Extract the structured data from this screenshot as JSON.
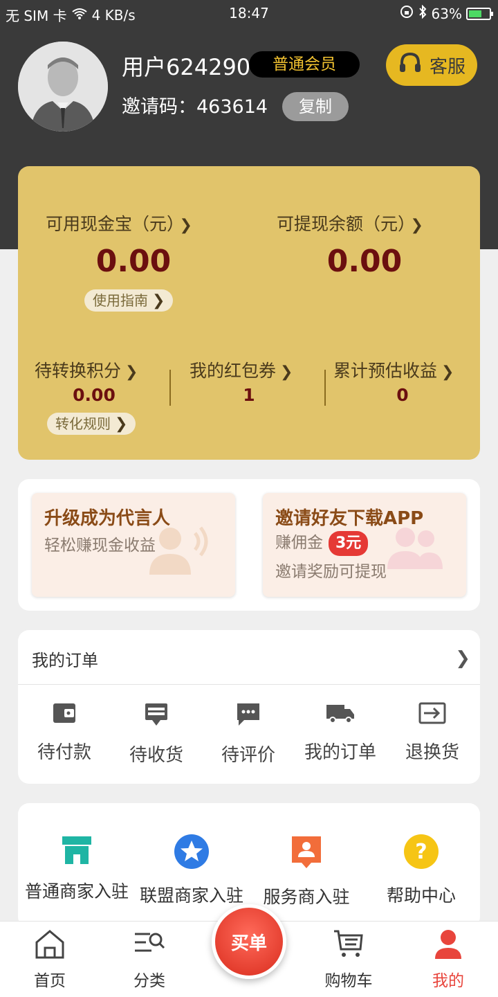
{
  "status_bar": {
    "carrier": "无 SIM 卡",
    "speed": "4 KB/s",
    "time": "18:47",
    "battery": "63%",
    "battery_level": 0.63
  },
  "profile": {
    "username": "用户624290",
    "member_level": "普通会员",
    "invite_label": "邀请码：",
    "invite_code": "463614",
    "copy_label": "复制",
    "service_label": "客服"
  },
  "wallet": {
    "cash_label": "可用现金宝（元）",
    "cash_value": "0.00",
    "withdraw_label": "可提现余额（元）",
    "withdraw_value": "0.00",
    "guide_label": "使用指南",
    "points_label": "待转换积分",
    "points_value": "0.00",
    "coupons_label": "我的红包券",
    "coupons_value": "1",
    "income_label": "累计预估收益",
    "income_value": "0",
    "rules_label": "转化规则"
  },
  "promos": {
    "spokesperson_title": "升级成为代言人",
    "spokesperson_sub": "轻松赚现金收益",
    "invite_title": "邀请好友下载APP",
    "invite_sub1": "赚佣金",
    "invite_badge": "3元",
    "invite_sub2": "邀请奖励可提现"
  },
  "orders": {
    "title": "我的订单",
    "items": [
      "待付款",
      "待收货",
      "待评价",
      "我的订单",
      "退换货"
    ]
  },
  "merchants": {
    "items": [
      "普通商家入驻",
      "联盟商家入驻",
      "服务商入驻",
      "帮助中心"
    ]
  },
  "tabbar": {
    "home": "首页",
    "category": "分类",
    "buy": "买单",
    "cart": "购物车",
    "mine": "我的"
  },
  "colors": {
    "accent_gold": "#e1c46b",
    "brand_red": "#e53935",
    "active_tab": "#e8453c"
  }
}
